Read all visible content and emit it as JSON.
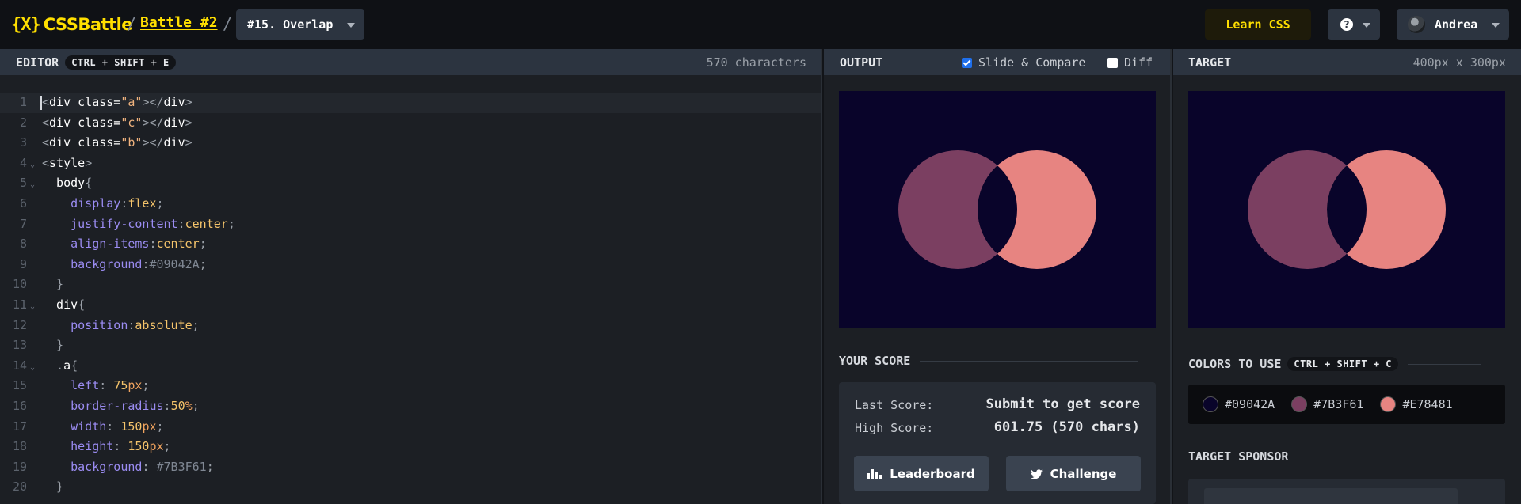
{
  "header": {
    "logo_mark": "{X}",
    "logo_text": "CSSBattle",
    "sep": "/",
    "battle_link": "Battle #2",
    "target_name": "#15. Overlap",
    "learn_css": "Learn CSS",
    "help_icon_text": "?",
    "user_name": "Andrea"
  },
  "editor": {
    "title": "EDITOR",
    "shortcut": "CTRL + SHIFT + E",
    "char_count": "570 characters"
  },
  "output": {
    "title": "OUTPUT",
    "slide_compare_label": "Slide & Compare",
    "slide_compare_checked": true,
    "diff_label": "Diff",
    "diff_checked": false
  },
  "score": {
    "title": "YOUR SCORE",
    "last_label": "Last Score:",
    "last_value": "Submit to get score",
    "high_label": "High Score:",
    "high_value": "601.75 (570 chars)",
    "leaderboard_btn": "Leaderboard",
    "challenge_btn": "Challenge"
  },
  "target": {
    "title": "TARGET",
    "dims": "400px x 300px",
    "colors_title": "COLORS TO USE",
    "colors_shortcut": "CTRL + SHIFT + C",
    "colors": [
      {
        "hex": "#09042A",
        "label": "#09042A"
      },
      {
        "hex": "#7B3F61",
        "label": "#7B3F61"
      },
      {
        "hex": "#E78481",
        "label": "#E78481"
      }
    ],
    "sponsor_title": "TARGET SPONSOR"
  },
  "canvas_colors": {
    "background": "#09042A",
    "a": "#7B3F61",
    "b": "#E78481",
    "c": "#09042A"
  },
  "code_lines": [
    [
      [
        "p",
        "<"
      ],
      [
        "tag",
        "div"
      ],
      [
        "attr",
        " class="
      ],
      [
        "str",
        "\"a\""
      ],
      [
        "p",
        "></"
      ],
      [
        "tag",
        "div"
      ],
      [
        "p",
        ">"
      ]
    ],
    [
      [
        "p",
        "<"
      ],
      [
        "tag",
        "div"
      ],
      [
        "attr",
        " class="
      ],
      [
        "str",
        "\"c\""
      ],
      [
        "p",
        "></"
      ],
      [
        "tag",
        "div"
      ],
      [
        "p",
        ">"
      ]
    ],
    [
      [
        "p",
        "<"
      ],
      [
        "tag",
        "div"
      ],
      [
        "attr",
        " class="
      ],
      [
        "str",
        "\"b\""
      ],
      [
        "p",
        "></"
      ],
      [
        "tag",
        "div"
      ],
      [
        "p",
        ">"
      ]
    ],
    [
      [
        "p",
        "<"
      ],
      [
        "tag",
        "style"
      ],
      [
        "p",
        ">"
      ]
    ],
    [
      [
        "sel",
        "  body"
      ],
      [
        "p",
        "{"
      ]
    ],
    [
      [
        "prop",
        "    display"
      ],
      [
        "p",
        ":"
      ],
      [
        "val",
        "flex"
      ],
      [
        "p",
        ";"
      ]
    ],
    [
      [
        "prop",
        "    justify-content"
      ],
      [
        "p",
        ":"
      ],
      [
        "val",
        "center"
      ],
      [
        "p",
        ";"
      ]
    ],
    [
      [
        "prop",
        "    align-items"
      ],
      [
        "p",
        ":"
      ],
      [
        "val",
        "center"
      ],
      [
        "p",
        ";"
      ]
    ],
    [
      [
        "prop",
        "    background"
      ],
      [
        "p",
        ":"
      ],
      [
        "hex",
        "#09042A"
      ],
      [
        "p",
        ";"
      ]
    ],
    [
      [
        "p",
        "  }"
      ]
    ],
    [
      [
        "sel",
        "  div"
      ],
      [
        "p",
        "{"
      ]
    ],
    [
      [
        "prop",
        "    position"
      ],
      [
        "p",
        ":"
      ],
      [
        "val",
        "absolute"
      ],
      [
        "p",
        ";"
      ]
    ],
    [
      [
        "p",
        "  }"
      ]
    ],
    [
      [
        "p",
        "  ."
      ],
      [
        "sel",
        "a"
      ],
      [
        "p",
        "{"
      ]
    ],
    [
      [
        "prop",
        "    left"
      ],
      [
        "p",
        ": "
      ],
      [
        "num",
        "75"
      ],
      [
        "unit",
        "px"
      ],
      [
        "p",
        ";"
      ]
    ],
    [
      [
        "prop",
        "    border-radius"
      ],
      [
        "p",
        ":"
      ],
      [
        "num",
        "50"
      ],
      [
        "unit",
        "%"
      ],
      [
        "p",
        ";"
      ]
    ],
    [
      [
        "prop",
        "    width"
      ],
      [
        "p",
        ": "
      ],
      [
        "num",
        "150"
      ],
      [
        "unit",
        "px"
      ],
      [
        "p",
        ";"
      ]
    ],
    [
      [
        "prop",
        "    height"
      ],
      [
        "p",
        ": "
      ],
      [
        "num",
        "150"
      ],
      [
        "unit",
        "px"
      ],
      [
        "p",
        ";"
      ]
    ],
    [
      [
        "prop",
        "    background"
      ],
      [
        "p",
        ": "
      ],
      [
        "hex",
        "#7B3F61"
      ],
      [
        "p",
        ";"
      ]
    ],
    [
      [
        "p",
        "  }"
      ]
    ]
  ],
  "folds": [
    4,
    5,
    11,
    14
  ]
}
